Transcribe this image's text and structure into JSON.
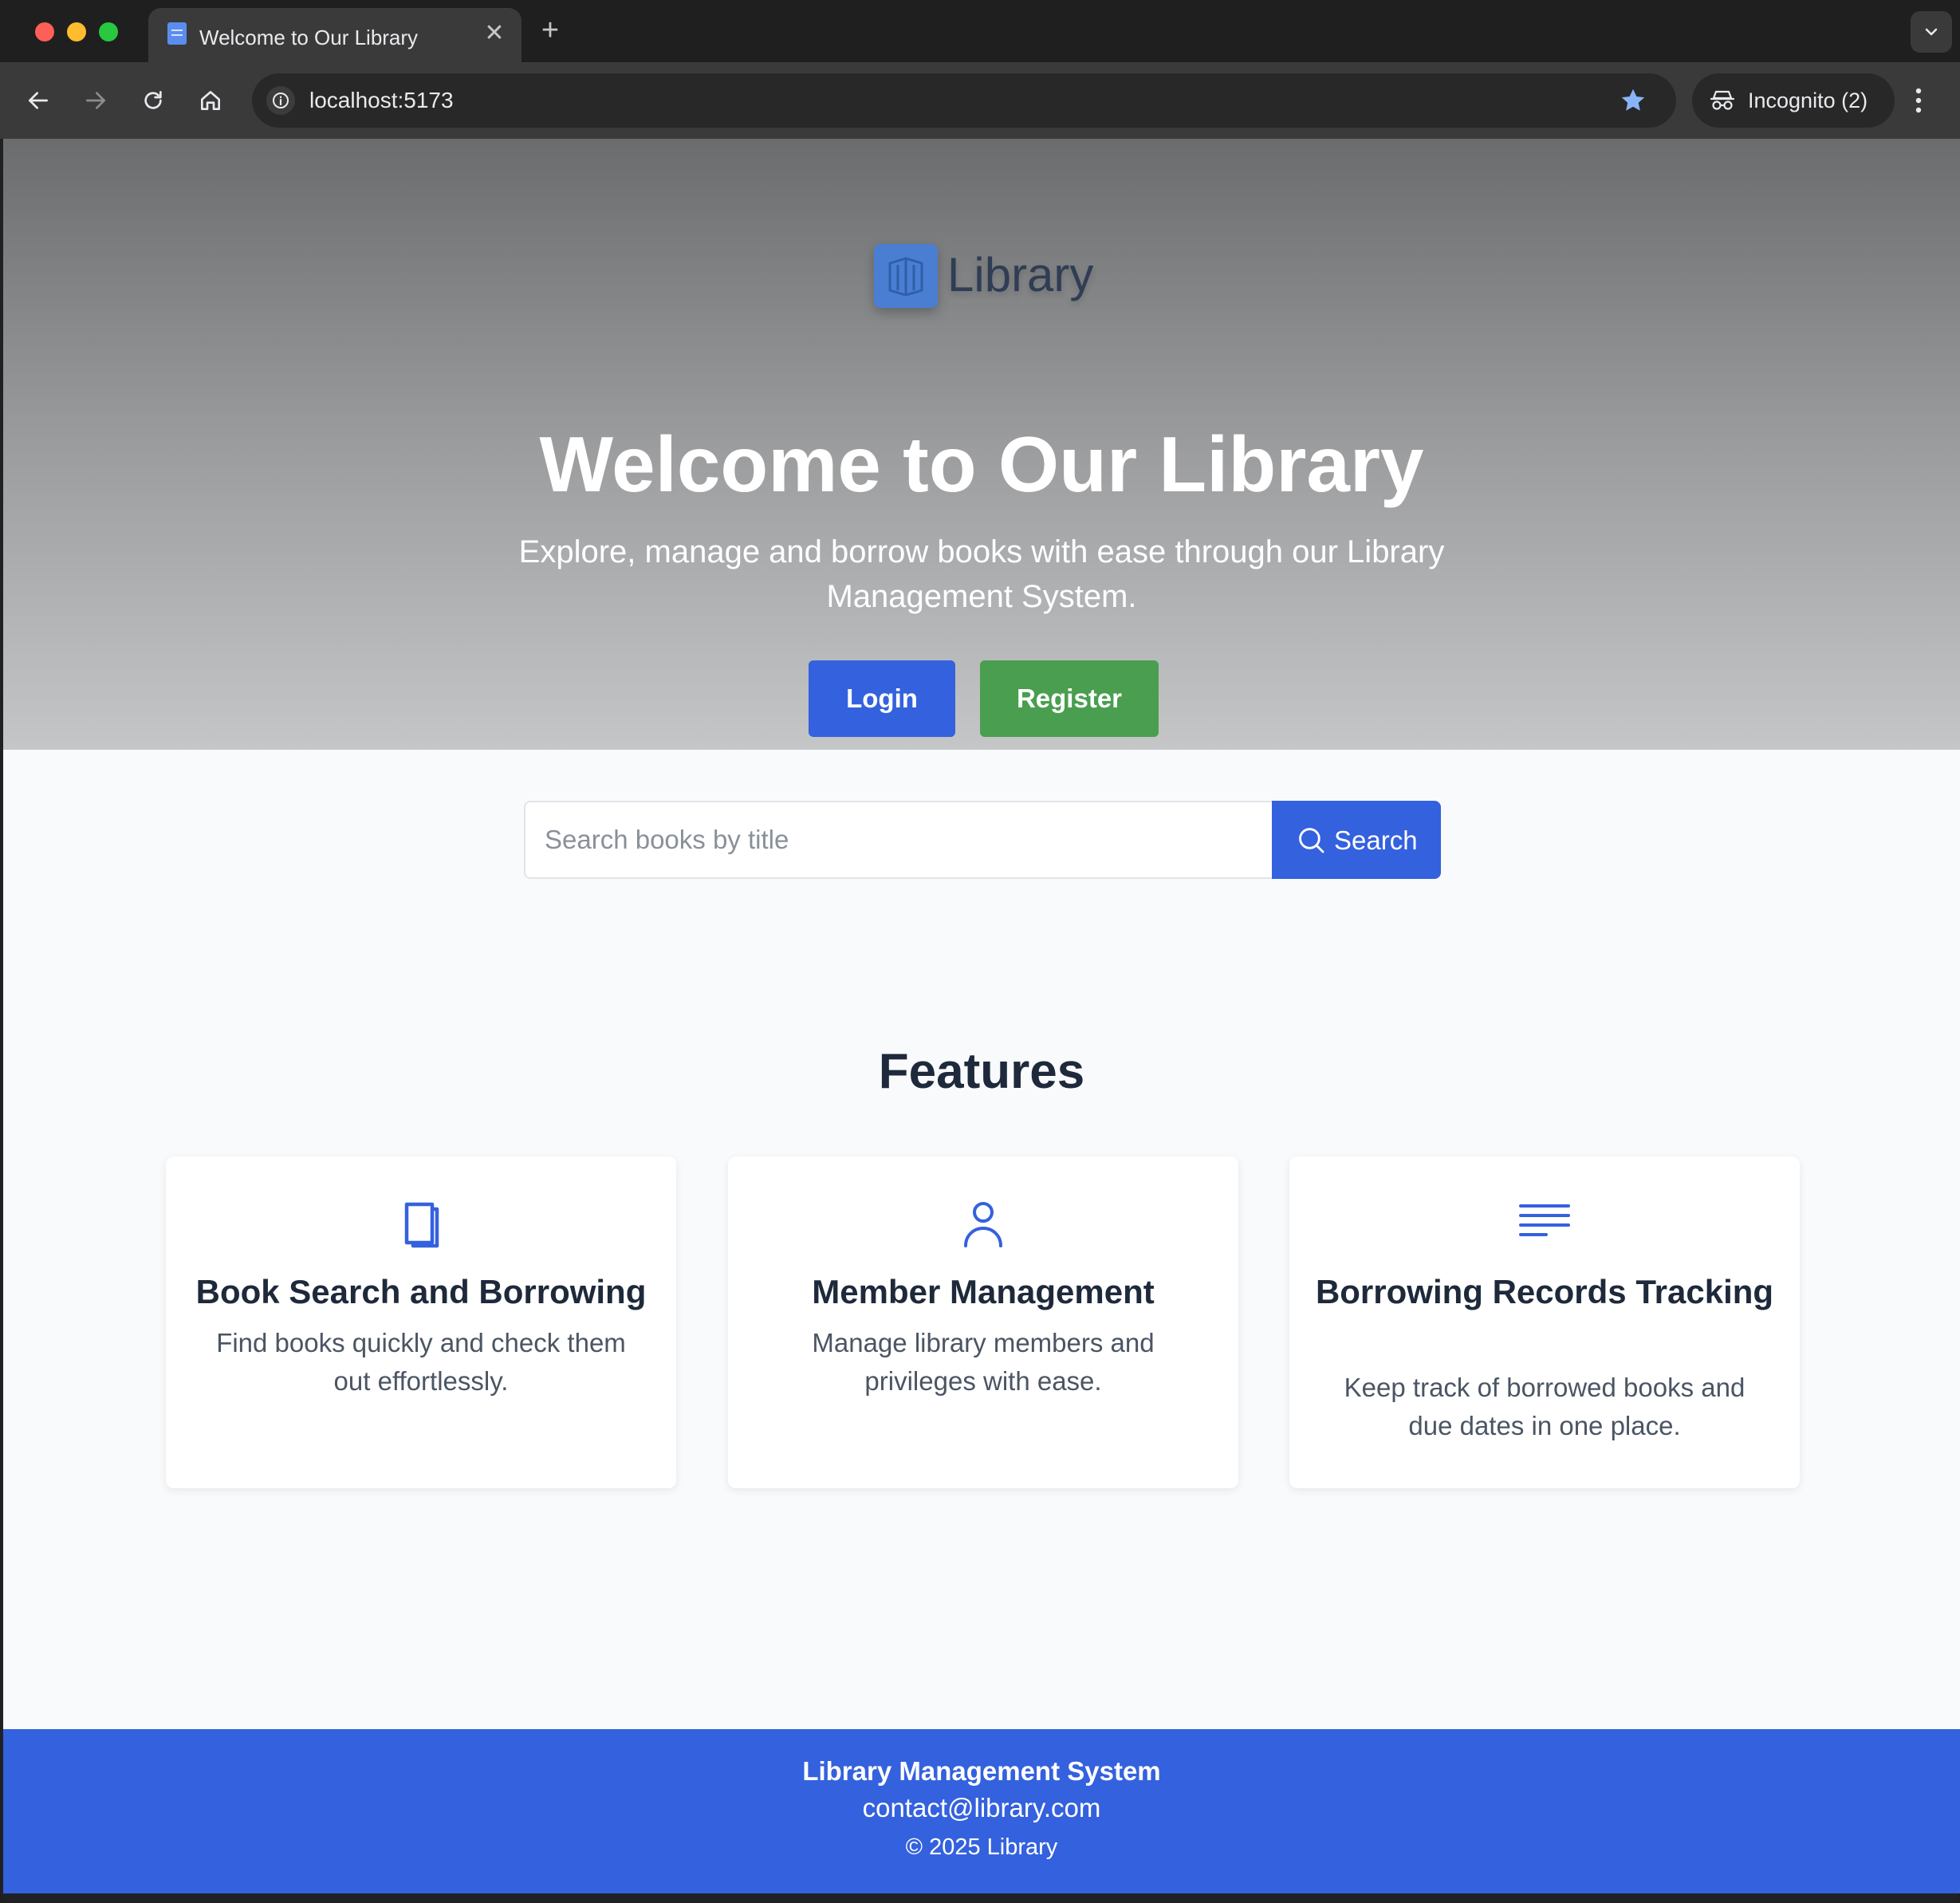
{
  "browser": {
    "tab_title": "Welcome to Our Library",
    "url": "localhost:5173",
    "profile_label": "Incognito (2)"
  },
  "hero": {
    "logo_text": "Library",
    "title": "Welcome to Our Library",
    "subtitle": "Explore, manage and borrow books with ease through our Library Management System.",
    "login_label": "Login",
    "register_label": "Register"
  },
  "search": {
    "placeholder": "Search books by title",
    "value": "",
    "button_label": "Search"
  },
  "features": {
    "title": "Features",
    "items": [
      {
        "icon": "book-icon",
        "title": "Book Search and Borrowing",
        "description": "Find books quickly and check them out effortlessly."
      },
      {
        "icon": "user-icon",
        "title": "Member Management",
        "description": "Manage library members and privileges with ease."
      },
      {
        "icon": "lines-icon",
        "title": "Borrowing Records Tracking",
        "description": "Keep track of borrowed books and due dates in one place."
      }
    ]
  },
  "footer": {
    "title": "Library Management System",
    "email": "contact@library.com",
    "copyright": "© 2025 Library"
  },
  "colors": {
    "primary": "#3461de",
    "success": "#4a9e4f",
    "heading": "#1e293b"
  }
}
